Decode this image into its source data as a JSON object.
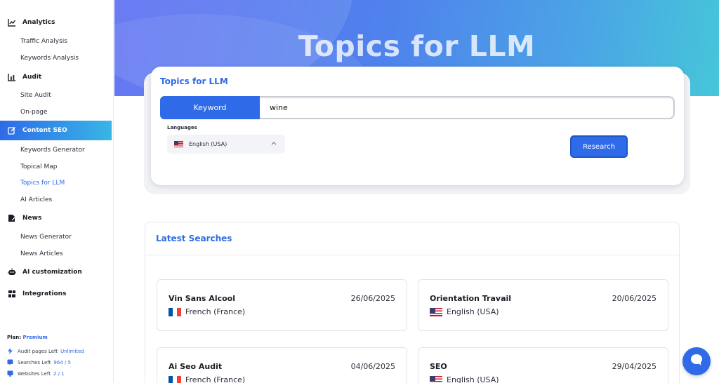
{
  "sidebar": {
    "sections": [
      {
        "label": "Analytics",
        "icon": "line-chart-icon"
      },
      {
        "label": "Audit",
        "icon": "bar-chart-icon"
      },
      {
        "label": "Content SEO",
        "icon": "edit-icon"
      },
      {
        "label": "News",
        "icon": "news-icon"
      },
      {
        "label": "AI customization",
        "icon": "robot-icon"
      },
      {
        "label": "Integrations",
        "icon": "blocks-icon"
      }
    ],
    "items": {
      "analytics": [
        "Traffic Analysis",
        "Keywords Analysis"
      ],
      "audit": [
        "Site Audit",
        "On-page"
      ],
      "content_seo": [
        "Keywords Generator",
        "Topical Map",
        "Topics for LLM",
        "AI Articles"
      ],
      "news": [
        "News Generator",
        "News Articles"
      ]
    },
    "active_section": "Content SEO",
    "active_item": "Topics for LLM",
    "plan_label": "Plan:",
    "plan_value": "Premium",
    "stats": [
      {
        "label": "Audit pages Left",
        "value": "Unlimited",
        "icon": "bolt-icon"
      },
      {
        "label": "Searches Left",
        "value": "964 / 5",
        "icon": "search-icon"
      },
      {
        "label": "Websites Left",
        "value": "2 / 1",
        "icon": "globe-icon"
      }
    ]
  },
  "hero": {
    "title": "Topics for LLM"
  },
  "search_card": {
    "title": "Topics for LLM",
    "mode_button": "Keyword",
    "keyword_value": "wine",
    "languages_label": "Languages",
    "language_selected": "English (USA)",
    "research_button": "Research"
  },
  "latest": {
    "title": "Latest Searches",
    "items": [
      {
        "name": "Vin Sans Alcool",
        "date": "26/06/2025",
        "language": "French (France)",
        "flag": "fr"
      },
      {
        "name": "Orientation Travail",
        "date": "20/06/2025",
        "language": "English (USA)",
        "flag": "us"
      },
      {
        "name": "Ai Seo Audit",
        "date": "04/06/2025",
        "language": "French (France)",
        "flag": "fr"
      },
      {
        "name": "SEO",
        "date": "29/04/2025",
        "language": "English (USA)",
        "flag": "us"
      }
    ]
  },
  "colors": {
    "accent": "#2f6be8",
    "accent_light": "#38b6e6"
  }
}
